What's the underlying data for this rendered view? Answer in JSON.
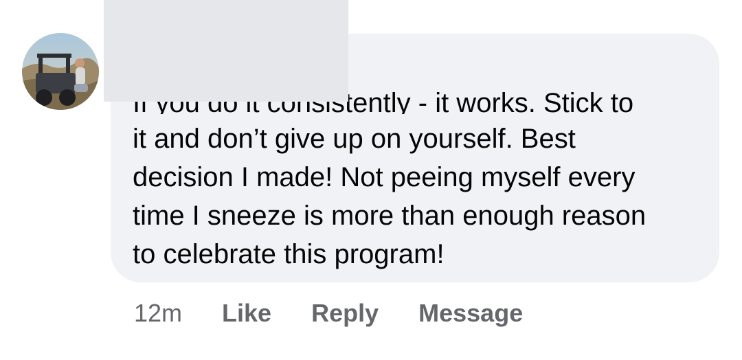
{
  "comment": {
    "avatar_icon": "profile-photo-avatar",
    "partial_first_line": "If you do it consistently - it works. Stick to",
    "lines": [
      "it and don’t give up on yourself. Best",
      "decision I made! Not peeing myself every",
      "time I sneeze is more than enough reason",
      "to celebrate this program!"
    ],
    "bubble_color": "#f0f2f5",
    "text_color": "#050505"
  },
  "actions": {
    "timestamp": "12m",
    "like_label": "Like",
    "reply_label": "Reply",
    "message_label": "Message",
    "color": "#65676b"
  }
}
